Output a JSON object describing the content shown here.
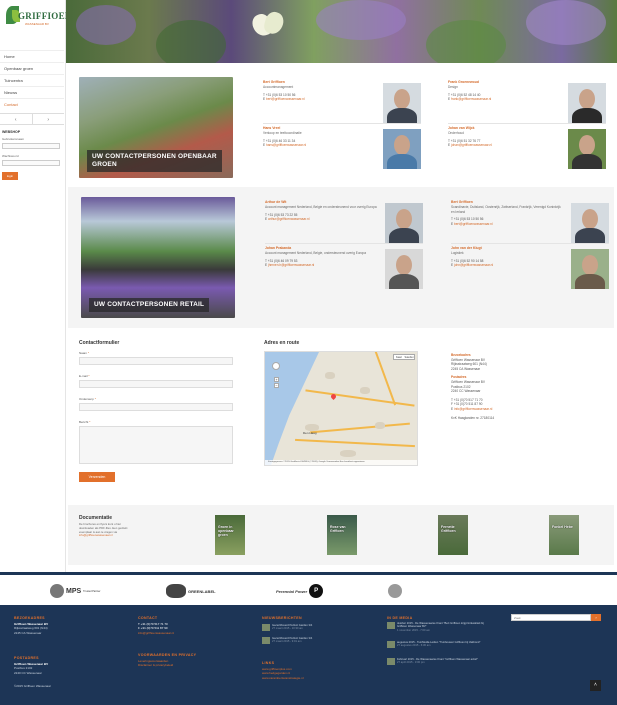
{
  "brand": {
    "name": "GRIFFIOEN",
    "sub": "WASSENAAR BV"
  },
  "nav": [
    "Home",
    "Openbaar groen",
    "Tuincentra",
    "Nieuws",
    "Contact"
  ],
  "nav_active": 4,
  "arrows": {
    "prev": "‹",
    "next": "›"
  },
  "webshop": {
    "title": "WEBSHOP",
    "user_label": "Gebruikersnaam",
    "pass_label": "Wachtwoord",
    "button": "login"
  },
  "section1": {
    "caption": "UW CONTACTPERSONEN OPENBAAR GROEN",
    "people": [
      {
        "name": "Bert Griffioen",
        "func": "Accountmanagement",
        "tel": "T  +31 (0)6 53 10 50 56",
        "mail": "bert@griffioenwassenaar.nl"
      },
      {
        "name": "Frank Groenewoud",
        "func": "Design",
        "tel": "T  +31 (0)6 52 48 14 40",
        "mail": "frank@griffioenwassenaar.nl"
      },
      {
        "name": "Hans Vreel",
        "func": "Verkoop en teeltcoordinatie",
        "tel": "T  +31 (0)6 46 33 11 34",
        "mail": "hans@griffioenwassenaar.nl"
      },
      {
        "name": "Johan van Wijck",
        "func": "Onderhoud",
        "tel": "T  +31 (0)6 51 32 76 77",
        "mail": "johan@griffioenwassenaar.nl"
      }
    ]
  },
  "section2": {
    "caption": "UW CONTACTPERSONEN RETAIL",
    "people": [
      {
        "name": "Arthur de Wit",
        "func": "Account management Nederland, Belgie en ondersteunend voor overig Europa",
        "tel": "T  +31 (0)6 53 73 22 55",
        "mail": "arthur@griffioenwassenaar.nl"
      },
      {
        "name": "Bert Griffioen",
        "func": "Scandinavie, Duitsland, Oostenrijk, Zwitserland, Frankrijk, Verenigd Koninkrijk en Ierland",
        "tel": "T  +31 (0)6 53 10 50 56",
        "mail": "bert@griffioenwassenaar.nl"
      },
      {
        "name": "Johan Prakanda",
        "func": "Account management Nederland, Belgie, ondersteunend overig Europa",
        "tel": "T  +31 (0)6 46 09 79 53",
        "mail": "jhmnen.h@griffioenwassenaar.nl"
      },
      {
        "name": "John van der Klugt",
        "func": "Logistiek",
        "tel": "T  +31 (0)6 52 90 14 58",
        "mail": "john@griffioenwassenaar.nl"
      }
    ]
  },
  "form": {
    "title": "Contactformulier",
    "name_label": "Naam",
    "email_label": "E-mail",
    "subject_label": "Onderwerp",
    "message_label": "Bericht",
    "required": "*",
    "submit": "Verzenden"
  },
  "route": {
    "title": "Adres en route",
    "map_type": [
      "Kaart",
      "Satelliet"
    ],
    "zoom_in": "+",
    "zoom_out": "−",
    "city": "Den Haag",
    "footer": "Kaartgegevens ©2015 GeoBasis-DE/BKG (©2009), Google  Voorwaarden  Een kaartfout rapporteren"
  },
  "address": {
    "visit_title": "Bezoekadres",
    "visit": [
      "Griffioen Wassenaar BV",
      "Rijksstraatweg 601 (N44)",
      "2245 CA Wassenaar"
    ],
    "post_title": "Postadres",
    "post": [
      "Griffioen Wassenaar BV",
      "Postbus 2102",
      "2240 CC Wassenaar"
    ],
    "tel": "T  +31 (0)70 517 71 70",
    "fax": "F  +31 (0)70 511 87 90",
    "mail": "info@griffioenwassenaar.nl",
    "kvk": "KvK Haaglanden nr. 27180114"
  },
  "documentation": {
    "title": "Documentatie",
    "text": "De brochures en flyers kunt u hier downloaden als PDF-files. Een gedrukt exemplaar is aan te vragen via",
    "mail": "info@griffioenwassenaar.nl",
    "items": [
      "Groen in openbaar groen",
      "Rose van Grffioen",
      "Fernetie Griffioen",
      "Fonkel Hebe"
    ]
  },
  "partners": [
    "MPS",
    "Trusted Partner",
    "GREENLABEL",
    "Perennial Power",
    "P"
  ],
  "footer": {
    "visit_title": "BEZOEKADRES",
    "visit": [
      "Griffioen Wassenaar BV",
      "Rijksstraatweg 601 (N44)",
      "2245 CA Wassenaar"
    ],
    "post_title": "POSTADRES",
    "post": [
      "Griffioen Wassenaar BV",
      "Postbus 2102",
      "2240 CC Wassenaar"
    ],
    "copyright": "©2015 Griffioen Wassenaar",
    "contact_title": "CONTACT",
    "contact": [
      "T +31 (0)70 517 71 70",
      "F +31 (0)70 511 87 90"
    ],
    "contact_mail": "info@griffioenwassenaar.nl",
    "terms_title": "VOORWAARDEN EN PRIVACY",
    "terms": [
      "Leveringsvoorwaarden",
      "Disclaimer & privacybeleid"
    ],
    "news_title": "NIEUWSBERICHTEN",
    "news": [
      {
        "title": "Gecertificeerd Perfect Garden 3/4",
        "date": "27 maart 2015 - 10:30 am"
      },
      {
        "title": "Gecertificeerd Perfect Garden 3/4",
        "date": "27 maart 2015 - 9:01 am"
      }
    ],
    "links_title": "LINKS",
    "links": [
      "www.griffioenplus.com",
      "www.hedgegarden.nl",
      "www.caramberisvanstrategie.nl"
    ],
    "media_title": "IN DE MEDIA",
    "media": [
      {
        "title": "oktober 2015 - De Wassenaarse Krant \"Bert Griffioen krijgt lintkwaliteit bij Griffioen Wassenaar BV\"",
        "date": "1 november 2015 - 7:00 am"
      },
      {
        "title": "augustus 2015 - TuinMedia Leiden \"Tuinbouwer Griffioen bij Vakbond\"",
        "date": "27 augustus 2015 - 6:30 am"
      },
      {
        "title": "Februari 2015 - De Wassenaarse Krant \"Griffioen Wassenaar actief\"",
        "date": "27 april 2015 - 3:00 pm"
      }
    ],
    "search_placeholder": "Zoek",
    "search_btn": "›",
    "to_top": "˄"
  }
}
